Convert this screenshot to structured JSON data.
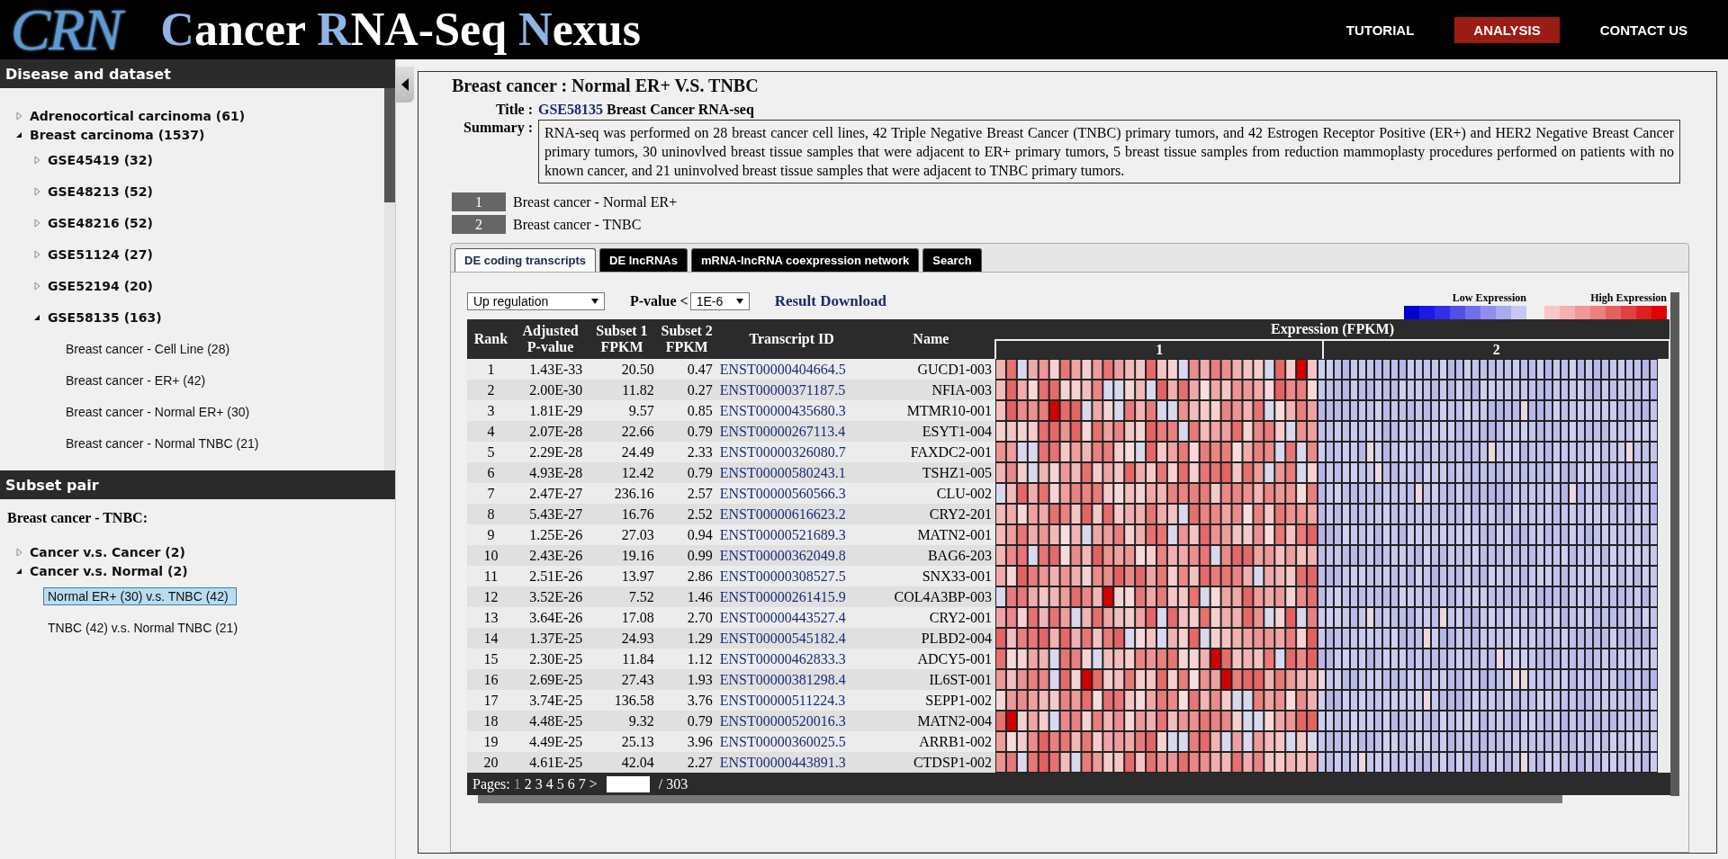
{
  "header": {
    "logo": "CRN",
    "title_parts": [
      {
        "text": "C",
        "accent": true
      },
      {
        "text": "ancer ",
        "accent": false
      },
      {
        "text": "R",
        "accent": true
      },
      {
        "text": "NA-Seq ",
        "accent": false
      },
      {
        "text": "N",
        "accent": true
      },
      {
        "text": "exus",
        "accent": false
      }
    ],
    "nav": [
      {
        "label": "TUTORIAL",
        "selected": false
      },
      {
        "label": "ANALYSIS",
        "selected": true
      },
      {
        "label": "CONTACT US",
        "selected": false
      }
    ]
  },
  "dataset_panel": {
    "title": "Disease and dataset",
    "tree": [
      {
        "label": "Adrenocortical carcinoma (61)",
        "kind": "group",
        "expanded": false
      },
      {
        "label": "Breast carcinoma (1537)",
        "kind": "group",
        "expanded": true,
        "children": [
          {
            "label": "GSE45419 (32)",
            "kind": "group",
            "expanded": false
          },
          {
            "label": "GSE48213 (52)",
            "kind": "group",
            "expanded": false
          },
          {
            "label": "GSE48216 (52)",
            "kind": "group",
            "expanded": false
          },
          {
            "label": "GSE51124 (27)",
            "kind": "group",
            "expanded": false
          },
          {
            "label": "GSE52194 (20)",
            "kind": "group",
            "expanded": false
          },
          {
            "label": "GSE58135 (163)",
            "kind": "group",
            "expanded": true,
            "children": [
              {
                "label": "Breast cancer - Cell Line (28)",
                "kind": "leaf",
                "selected": false
              },
              {
                "label": "Breast cancer - ER+ (42)",
                "kind": "leaf",
                "selected": false
              },
              {
                "label": "Breast cancer - Normal ER+ (30)",
                "kind": "leaf",
                "selected": false
              },
              {
                "label": "Breast cancer - Normal TNBC (21)",
                "kind": "leaf",
                "selected": false
              }
            ]
          }
        ]
      }
    ]
  },
  "subset_panel": {
    "title": "Subset pair",
    "heading": "Breast cancer - TNBC:",
    "tree": [
      {
        "label": "Cancer v.s. Cancer (2)",
        "kind": "group",
        "expanded": false
      },
      {
        "label": "Cancer v.s. Normal (2)",
        "kind": "group",
        "expanded": true,
        "children": [
          {
            "label": "Normal ER+ (30) v.s. TNBC (42)",
            "kind": "leaf",
            "selected": true
          },
          {
            "label": "TNBC (42) v.s. Normal TNBC (21)",
            "kind": "leaf",
            "selected": false
          }
        ]
      }
    ]
  },
  "main": {
    "heading": "Breast cancer : Normal ER+ V.S. TNBC",
    "title_label": "Title :",
    "title_link": "GSE58135",
    "title_text": "Breast Cancer RNA-seq",
    "summary_label": "Summary :",
    "summary": "RNA-seq was performed on 28 breast cancer cell lines, 42 Triple Negative Breast Cancer (TNBC) primary tumors, and 42 Estrogen Receptor Positive (ER+) and HER2 Negative Breast Cancer primary tumors, 30 uninovlved breast tissue samples that were adjacent to ER+ primary tumors, 5 breast tissue samples from reduction mammoplasty procedures performed on patients with no known cancer, and 21 uninvolved breast tissue samples that were adjacent to TNBC primary tumors.",
    "subsets": [
      {
        "index": "1",
        "label": "Breast cancer - Normal ER+"
      },
      {
        "index": "2",
        "label": "Breast cancer - TNBC"
      }
    ],
    "tabs": [
      {
        "label": "DE coding transcripts",
        "selected": true
      },
      {
        "label": "DE lncRNAs",
        "selected": false
      },
      {
        "label": "mRNA-lncRNA coexpression network",
        "selected": false
      },
      {
        "label": "Search",
        "selected": false
      }
    ],
    "filters": {
      "regulation": "Up regulation",
      "pvalue_label": "P-value <",
      "pvalue": "1E-6",
      "download": "Result Download"
    },
    "legend": {
      "low": "Low Expression",
      "high": "High Expression"
    },
    "table": {
      "columns": [
        "Rank",
        "Adjusted P-value",
        "Subset 1 FPKM",
        "Subset 2 FPKM",
        "Transcript ID",
        "Name"
      ],
      "expression_header": "Expression (FPKM)",
      "groups": [
        "1",
        "2"
      ],
      "rows": [
        [
          "1",
          "1.43E-33",
          "20.50",
          "0.47",
          "ENST00000404664.5",
          "GUCD1-003"
        ],
        [
          "2",
          "2.00E-30",
          "11.82",
          "0.27",
          "ENST00000371187.5",
          "NFIA-003"
        ],
        [
          "3",
          "1.81E-29",
          "9.57",
          "0.85",
          "ENST00000435680.3",
          "MTMR10-001"
        ],
        [
          "4",
          "2.07E-28",
          "22.66",
          "0.79",
          "ENST00000267113.4",
          "ESYT1-004"
        ],
        [
          "5",
          "2.29E-28",
          "24.49",
          "2.33",
          "ENST00000326080.7",
          "FAXDC2-001"
        ],
        [
          "6",
          "4.93E-28",
          "12.42",
          "0.79",
          "ENST00000580243.1",
          "TSHZ1-005"
        ],
        [
          "7",
          "2.47E-27",
          "236.16",
          "2.57",
          "ENST00000560566.3",
          "CLU-002"
        ],
        [
          "8",
          "5.43E-27",
          "16.76",
          "2.52",
          "ENST00000616623.2",
          "CRY2-201"
        ],
        [
          "9",
          "1.25E-26",
          "27.03",
          "0.94",
          "ENST00000521689.3",
          "MATN2-001"
        ],
        [
          "10",
          "2.43E-26",
          "19.16",
          "0.99",
          "ENST00000362049.8",
          "BAG6-203"
        ],
        [
          "11",
          "2.51E-26",
          "13.97",
          "2.86",
          "ENST00000308527.5",
          "SNX33-001"
        ],
        [
          "12",
          "3.52E-26",
          "7.52",
          "1.46",
          "ENST00000261415.9",
          "COL4A3BP-003"
        ],
        [
          "13",
          "3.64E-26",
          "17.08",
          "2.70",
          "ENST00000443527.4",
          "CRY2-001"
        ],
        [
          "14",
          "1.37E-25",
          "24.93",
          "1.29",
          "ENST00000545182.4",
          "PLBD2-004"
        ],
        [
          "15",
          "2.30E-25",
          "11.84",
          "1.12",
          "ENST00000462833.3",
          "ADCY5-001"
        ],
        [
          "16",
          "2.69E-25",
          "27.43",
          "1.93",
          "ENST00000381298.4",
          "IL6ST-001"
        ],
        [
          "17",
          "3.74E-25",
          "136.58",
          "3.76",
          "ENST00000511224.3",
          "SEPP1-002"
        ],
        [
          "18",
          "4.48E-25",
          "9.32",
          "0.79",
          "ENST00000520016.3",
          "MATN2-004"
        ],
        [
          "19",
          "4.49E-25",
          "25.13",
          "3.96",
          "ENST00000360025.5",
          "ARRB1-002"
        ],
        [
          "20",
          "4.61E-25",
          "42.04",
          "2.27",
          "ENST00000443891.3",
          "CTDSP1-002"
        ]
      ]
    },
    "pager": {
      "label": "Pages:",
      "pages": [
        {
          "label": "1",
          "selected": true
        },
        {
          "label": "2",
          "selected": false
        },
        {
          "label": "3",
          "selected": false
        },
        {
          "label": "4",
          "selected": false
        },
        {
          "label": "5",
          "selected": false
        },
        {
          "label": "6",
          "selected": false
        },
        {
          "label": "7",
          "selected": false
        }
      ],
      "next": ">",
      "total": "/ 303"
    }
  }
}
